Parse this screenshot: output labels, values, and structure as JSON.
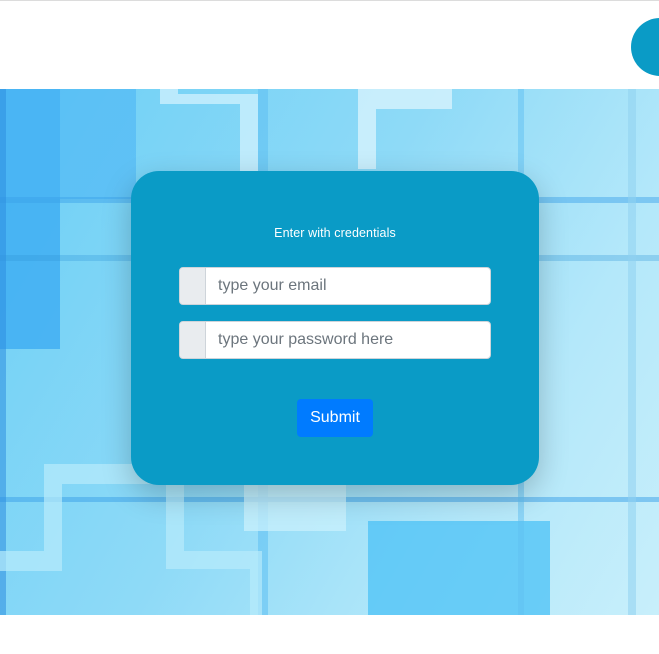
{
  "login": {
    "title": "Enter with credentials",
    "email_placeholder": "type your email",
    "password_placeholder": "type your password here",
    "submit_label": "Submit"
  },
  "colors": {
    "card": "#0a9bc6",
    "button": "#007bff",
    "avatar": "#0a9bc6"
  }
}
